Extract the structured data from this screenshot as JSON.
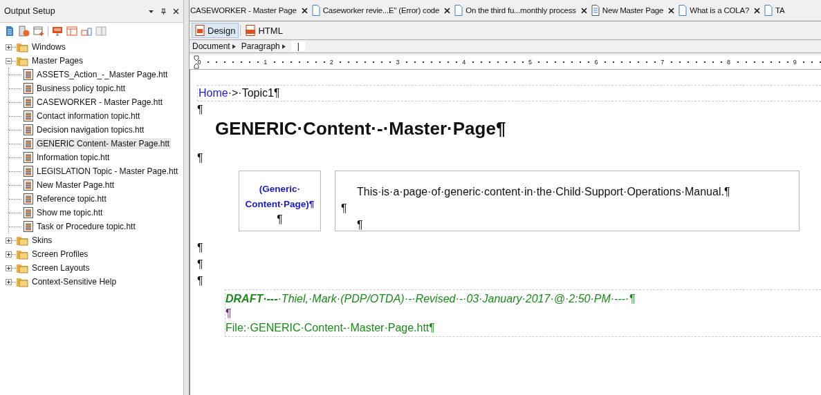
{
  "panel": {
    "title": "Output Setup"
  },
  "tree": [
    {
      "label": "Windows",
      "expanded": false
    },
    {
      "label": "Master Pages",
      "expanded": true,
      "children": [
        {
          "label": "ASSETS_Action_-_Master Page.htt",
          "selected": false
        },
        {
          "label": "Business policy topic.htt",
          "selected": false
        },
        {
          "label": "CASEWORKER - Master Page.htt",
          "selected": false
        },
        {
          "label": "Contact information topic.htt",
          "selected": false
        },
        {
          "label": "Decision navigation topics.htt",
          "selected": false
        },
        {
          "label": "GENERIC Content- Master Page.htt",
          "selected": true
        },
        {
          "label": "Information topic.htt",
          "selected": false
        },
        {
          "label": "LEGISLATION Topic - Master Page.htt",
          "selected": false
        },
        {
          "label": "New Master Page.htt",
          "selected": false
        },
        {
          "label": "Reference topic.htt",
          "selected": false
        },
        {
          "label": "Show me topic.htt",
          "selected": false
        },
        {
          "label": "Task or Procedure topic.htt",
          "selected": false
        }
      ]
    },
    {
      "label": "Skins",
      "expanded": false
    },
    {
      "label": "Screen Profiles",
      "expanded": false
    },
    {
      "label": "Screen Layouts",
      "expanded": false
    },
    {
      "label": "Context-Sensitive Help",
      "expanded": false
    }
  ],
  "tabs": [
    {
      "label": "CASEWORKER - Master Page",
      "kind": "none"
    },
    {
      "label": "Caseworker revie...E\" (Error) code",
      "kind": "document"
    },
    {
      "label": "On the third fu...monthly process",
      "kind": "document"
    },
    {
      "label": "New Master Page",
      "kind": "master"
    },
    {
      "label": "What is a COLA?",
      "kind": "document"
    },
    {
      "label": "TA",
      "kind": "document"
    }
  ],
  "views": [
    {
      "label": "Design",
      "selected": true
    },
    {
      "label": "HTML",
      "selected": false
    }
  ],
  "path_bar": {
    "items": [
      "Document",
      "Paragraph"
    ],
    "tag_field": "|"
  },
  "ruler": [
    "0",
    "1",
    "2",
    "3",
    "4",
    "5",
    "6",
    "7",
    "8",
    "9"
  ],
  "document": [
    {
      "kind": "breadcrumb",
      "link": "Home",
      "text": "·>·Topic1¶"
    },
    {
      "kind": "mark",
      "text": "¶"
    },
    {
      "kind": "heading",
      "text": "GENERIC·Content·-·Master·Page¶"
    },
    {
      "kind": "mark",
      "text": "¶"
    },
    {
      "kind": "table",
      "left": [
        "(Generic·",
        "Content·Page)¶",
        "¶"
      ],
      "right": [
        "This·is·a·page·of·generic·content·in·the·Child·Support·Operations·Manual.¶",
        "¶",
        "¶"
      ]
    },
    {
      "kind": "mark",
      "text": "¶"
    },
    {
      "kind": "mark",
      "text": "¶"
    },
    {
      "kind": "mark",
      "text": "¶"
    },
    {
      "kind": "footer",
      "lines": [
        "**DRAFT·---**·Thiel,·Mark·(PDP/OTDA)·-·Revised·-·03·January·2017·@·2:50·PM·---·¶",
        "¶",
        "File:·GENERIC·Content-·Master·Page.htt¶"
      ]
    }
  ]
}
